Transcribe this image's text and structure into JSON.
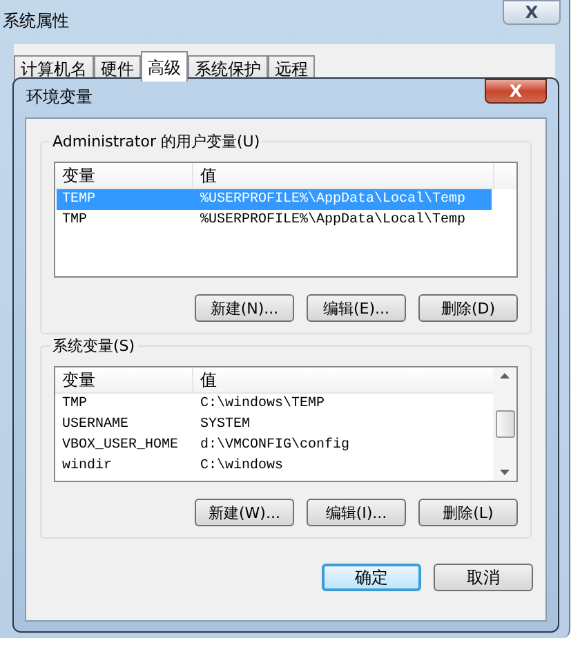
{
  "window": {
    "title": "系统属性",
    "close": "X"
  },
  "tabs": [
    {
      "label": "计算机名",
      "selected": false
    },
    {
      "label": "硬件",
      "selected": false
    },
    {
      "label": "高级",
      "selected": true
    },
    {
      "label": "系统保护",
      "selected": false
    },
    {
      "label": "远程",
      "selected": false
    }
  ],
  "dialog": {
    "title": "环境变量",
    "close": "X",
    "groups": [
      {
        "title": "Administrator 的用户变量(U)",
        "scrollbar": false,
        "columns": [
          "变量",
          "值"
        ],
        "rows": [
          {
            "name": "TEMP",
            "value": "%USERPROFILE%\\AppData\\Local\\Temp",
            "selected": true
          },
          {
            "name": "TMP",
            "value": "%USERPROFILE%\\AppData\\Local\\Temp",
            "selected": false
          }
        ],
        "buttons": [
          "新建(N)...",
          "编辑(E)...",
          "删除(D)"
        ]
      },
      {
        "title": "系统变量(S)",
        "scrollbar": true,
        "columns": [
          "变量",
          "值"
        ],
        "rows": [
          {
            "name": "TMP",
            "value": "C:\\windows\\TEMP",
            "selected": false
          },
          {
            "name": "USERNAME",
            "value": "SYSTEM",
            "selected": false
          },
          {
            "name": "VBOX_USER_HOME",
            "value": "d:\\VMCONFIG\\config",
            "selected": false
          },
          {
            "name": "windir",
            "value": "C:\\windows",
            "selected": false
          }
        ],
        "buttons": [
          "新建(W)...",
          "编辑(I)...",
          "删除(L)"
        ]
      }
    ],
    "footer_buttons": [
      {
        "label": "确定",
        "kind": "default"
      },
      {
        "label": "取消",
        "kind": "normal"
      }
    ]
  }
}
